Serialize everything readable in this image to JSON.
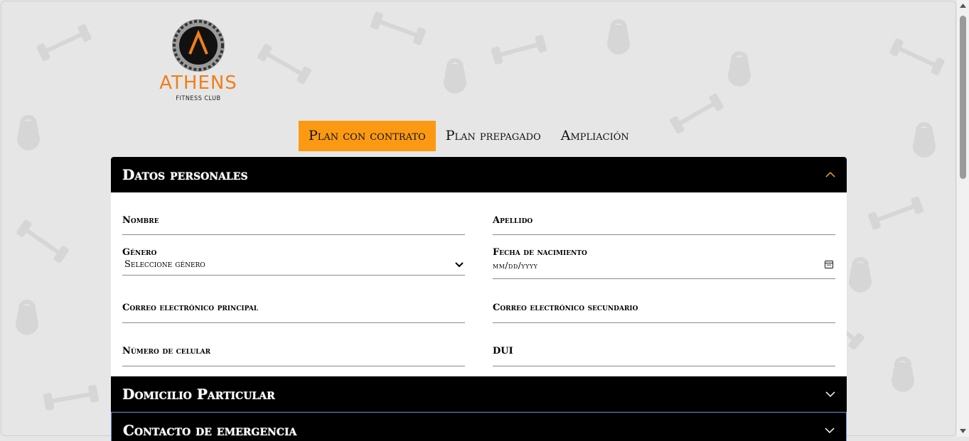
{
  "brand": {
    "name": "ATHENS",
    "tagline": "FITNESS CLUB",
    "accent_color": "#ef7f1a"
  },
  "tabs": [
    {
      "label": "Plan con contrato",
      "active": true
    },
    {
      "label": "Plan prepagado",
      "active": false
    },
    {
      "label": "Ampliación",
      "active": false
    }
  ],
  "tab_active_color": "#fb9a12",
  "sections": {
    "personal": {
      "title": "Datos personales",
      "expanded": true,
      "icon": "chevron-up-icon"
    },
    "address": {
      "title": "Domicilio Particular",
      "expanded": false,
      "icon": "chevron-down-icon"
    },
    "emergency": {
      "title": "Contacto de emergencia",
      "expanded": false,
      "icon": "chevron-down-icon"
    }
  },
  "form": {
    "nombre": {
      "label": "Nombre",
      "value": ""
    },
    "apellido": {
      "label": "Apellido",
      "value": ""
    },
    "genero": {
      "label": "Género",
      "selected": "Seleccione género"
    },
    "fecha": {
      "label": "Fecha de nacimiento",
      "placeholder": "mm/dd/yyyy"
    },
    "correo_principal": {
      "label": "Correo electrónico principal",
      "value": ""
    },
    "correo_secundario": {
      "label": "Correo electrónico secundario",
      "value": ""
    },
    "celular": {
      "label": "Número de celular",
      "value": ""
    },
    "dui": {
      "label": "DUI",
      "value": ""
    }
  }
}
